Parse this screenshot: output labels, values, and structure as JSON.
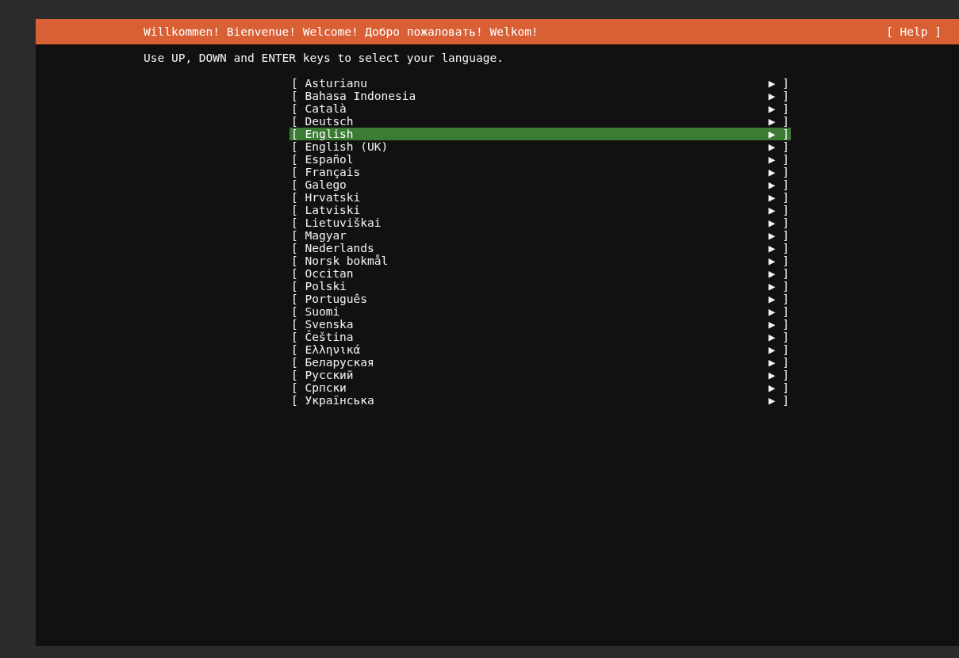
{
  "header": {
    "title": "Willkommen! Bienvenue! Welcome! Добро пожаловать! Welkom!",
    "help": "[ Help ]"
  },
  "instruction": "Use UP, DOWN and ENTER keys to select your language.",
  "languages": [
    {
      "open": "[",
      "label": "Asturianu",
      "arrow": "▶",
      "close": "]",
      "selected": false
    },
    {
      "open": "[",
      "label": "Bahasa Indonesia",
      "arrow": "▶",
      "close": "]",
      "selected": false
    },
    {
      "open": "[",
      "label": "Català",
      "arrow": "▶",
      "close": "]",
      "selected": false
    },
    {
      "open": "[",
      "label": "Deutsch",
      "arrow": "▶",
      "close": "]",
      "selected": false
    },
    {
      "open": "[",
      "label": "English",
      "arrow": "▶",
      "close": "]",
      "selected": true
    },
    {
      "open": "[",
      "label": "English (UK)",
      "arrow": "▶",
      "close": "]",
      "selected": false
    },
    {
      "open": "[",
      "label": "Español",
      "arrow": "▶",
      "close": "]",
      "selected": false
    },
    {
      "open": "[",
      "label": "Français",
      "arrow": "▶",
      "close": "]",
      "selected": false
    },
    {
      "open": "[",
      "label": "Galego",
      "arrow": "▶",
      "close": "]",
      "selected": false
    },
    {
      "open": "[",
      "label": "Hrvatski",
      "arrow": "▶",
      "close": "]",
      "selected": false
    },
    {
      "open": "[",
      "label": "Latviski",
      "arrow": "▶",
      "close": "]",
      "selected": false
    },
    {
      "open": "[",
      "label": "Lietuviškai",
      "arrow": "▶",
      "close": "]",
      "selected": false
    },
    {
      "open": "[",
      "label": "Magyar",
      "arrow": "▶",
      "close": "]",
      "selected": false
    },
    {
      "open": "[",
      "label": "Nederlands",
      "arrow": "▶",
      "close": "]",
      "selected": false
    },
    {
      "open": "[",
      "label": "Norsk bokmål",
      "arrow": "▶",
      "close": "]",
      "selected": false
    },
    {
      "open": "[",
      "label": "Occitan",
      "arrow": "▶",
      "close": "]",
      "selected": false
    },
    {
      "open": "[",
      "label": "Polski",
      "arrow": "▶",
      "close": "]",
      "selected": false
    },
    {
      "open": "[",
      "label": "Português",
      "arrow": "▶",
      "close": "]",
      "selected": false
    },
    {
      "open": "[",
      "label": "Suomi",
      "arrow": "▶",
      "close": "]",
      "selected": false
    },
    {
      "open": "[",
      "label": "Svenska",
      "arrow": "▶",
      "close": "]",
      "selected": false
    },
    {
      "open": "[",
      "label": "Čeština",
      "arrow": "▶",
      "close": "]",
      "selected": false
    },
    {
      "open": "[",
      "label": "Ελληνικά",
      "arrow": "▶",
      "close": "]",
      "selected": false
    },
    {
      "open": "[",
      "label": "Беларуская",
      "arrow": "▶",
      "close": "]",
      "selected": false
    },
    {
      "open": "[",
      "label": "Русский",
      "arrow": "▶",
      "close": "]",
      "selected": false
    },
    {
      "open": "[",
      "label": "Српски",
      "arrow": "▶",
      "close": "]",
      "selected": false
    },
    {
      "open": "[",
      "label": "Українська",
      "arrow": "▶",
      "close": "]",
      "selected": false
    }
  ]
}
